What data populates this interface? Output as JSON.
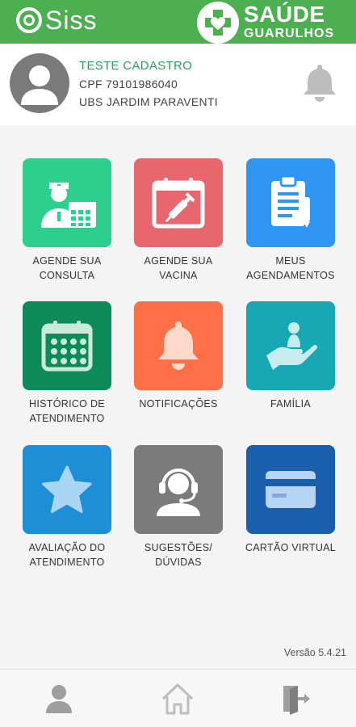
{
  "header": {
    "logo_left_text": "Siss",
    "logo_right_line1": "SAÚDE",
    "logo_right_line2": "GUARULHOS"
  },
  "profile": {
    "name": "TESTE CADASTRO",
    "cpf": "CPF 79101986040",
    "unit": "UBS JARDIM PARAVENTI"
  },
  "menu": [
    {
      "line1": "AGENDE SUA",
      "line2": "CONSULTA",
      "color": "#2ecf8e",
      "icon": "doctor-calendar-icon"
    },
    {
      "line1": "AGENDE SUA",
      "line2": "VACINA",
      "color": "#e8676e",
      "icon": "vaccine-calendar-icon"
    },
    {
      "line1": "MEUS",
      "line2": "AGENDAMENTOS",
      "color": "#2f96f3",
      "icon": "clipboard-icon"
    },
    {
      "line1": "HISTÓRICO DE",
      "line2": "ATENDIMENTO",
      "color": "#0d8a5a",
      "icon": "calendar-grid-icon"
    },
    {
      "line1": "NOTIFICAÇÕES",
      "line2": "",
      "color": "#ff7048",
      "icon": "bell-icon"
    },
    {
      "line1": "FAMÍLIA",
      "line2": "",
      "color": "#18a8b3",
      "icon": "family-hand-icon"
    },
    {
      "line1": "AVALIAÇÃO DO",
      "line2": "ATENDIMENTO",
      "color": "#1e8fd6",
      "icon": "star-icon"
    },
    {
      "line1": "SUGESTÕES/",
      "line2": "DÚVIDAS",
      "color": "#7b7b7b",
      "icon": "support-agent-icon"
    },
    {
      "line1": "CARTÃO VIRTUAL",
      "line2": "",
      "color": "#1a5fae",
      "icon": "credit-card-icon"
    }
  ],
  "footer": {
    "version": "Versão 5.4.21"
  },
  "bottom_nav": [
    "profile-icon",
    "home-icon",
    "logout-icon"
  ]
}
